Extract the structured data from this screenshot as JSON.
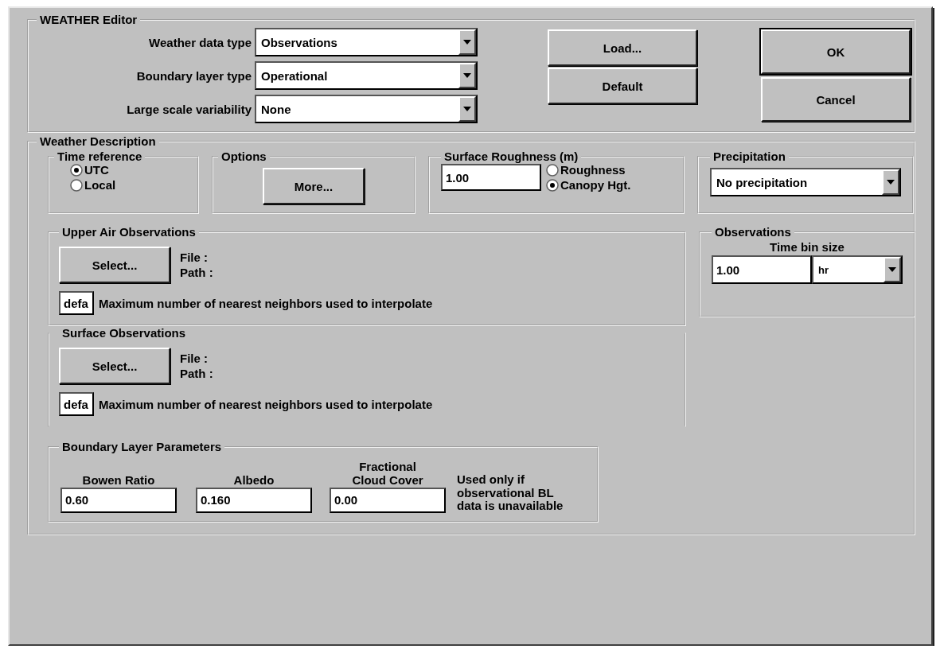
{
  "editor": {
    "title": "WEATHER Editor",
    "settings": [
      {
        "label": "Weather data type",
        "value": "Observations"
      },
      {
        "label": "Boundary layer type",
        "value": "Operational"
      },
      {
        "label": "Large scale variability",
        "value": "None"
      }
    ],
    "buttons": {
      "load": "Load...",
      "default": "Default",
      "ok": "OK",
      "cancel": "Cancel"
    }
  },
  "description": {
    "title": "Weather Description",
    "time_reference": {
      "title": "Time reference",
      "options": [
        {
          "label": "UTC",
          "selected": true
        },
        {
          "label": "Local",
          "selected": false
        }
      ]
    },
    "options": {
      "title": "Options",
      "button": "More..."
    },
    "surface_roughness": {
      "title": "Surface Roughness (m)",
      "value": "1.00",
      "options": [
        {
          "label": "Roughness",
          "selected": false
        },
        {
          "label": "Canopy Hgt.",
          "selected": true
        }
      ]
    },
    "precipitation": {
      "title": "Precipitation",
      "value": "No precipitation"
    },
    "upper_air": {
      "title": "Upper Air Observations",
      "button": "Select...",
      "file_label": "File :",
      "path_label": "Path :",
      "neighbors_value": "defa",
      "neighbors_label": "Maximum number of nearest neighbors used to interpolate"
    },
    "observations": {
      "title": "Observations",
      "label": "Time bin size",
      "value": "1.00",
      "unit": "hr"
    },
    "surface_obs": {
      "title": "Surface Observations",
      "button": "Select...",
      "file_label": "File :",
      "path_label": "Path :",
      "neighbors_value": "defa",
      "neighbors_label": "Maximum number of nearest neighbors used to interpolate"
    },
    "boundary_layer": {
      "title": "Boundary Layer Parameters",
      "fields": [
        {
          "label": "Bowen Ratio",
          "value": "0.60"
        },
        {
          "label": "Albedo",
          "value": "0.160"
        },
        {
          "label": "Fractional Cloud Cover",
          "value": "0.00"
        }
      ],
      "note": "Used only if observational BL data is unavailable"
    }
  }
}
